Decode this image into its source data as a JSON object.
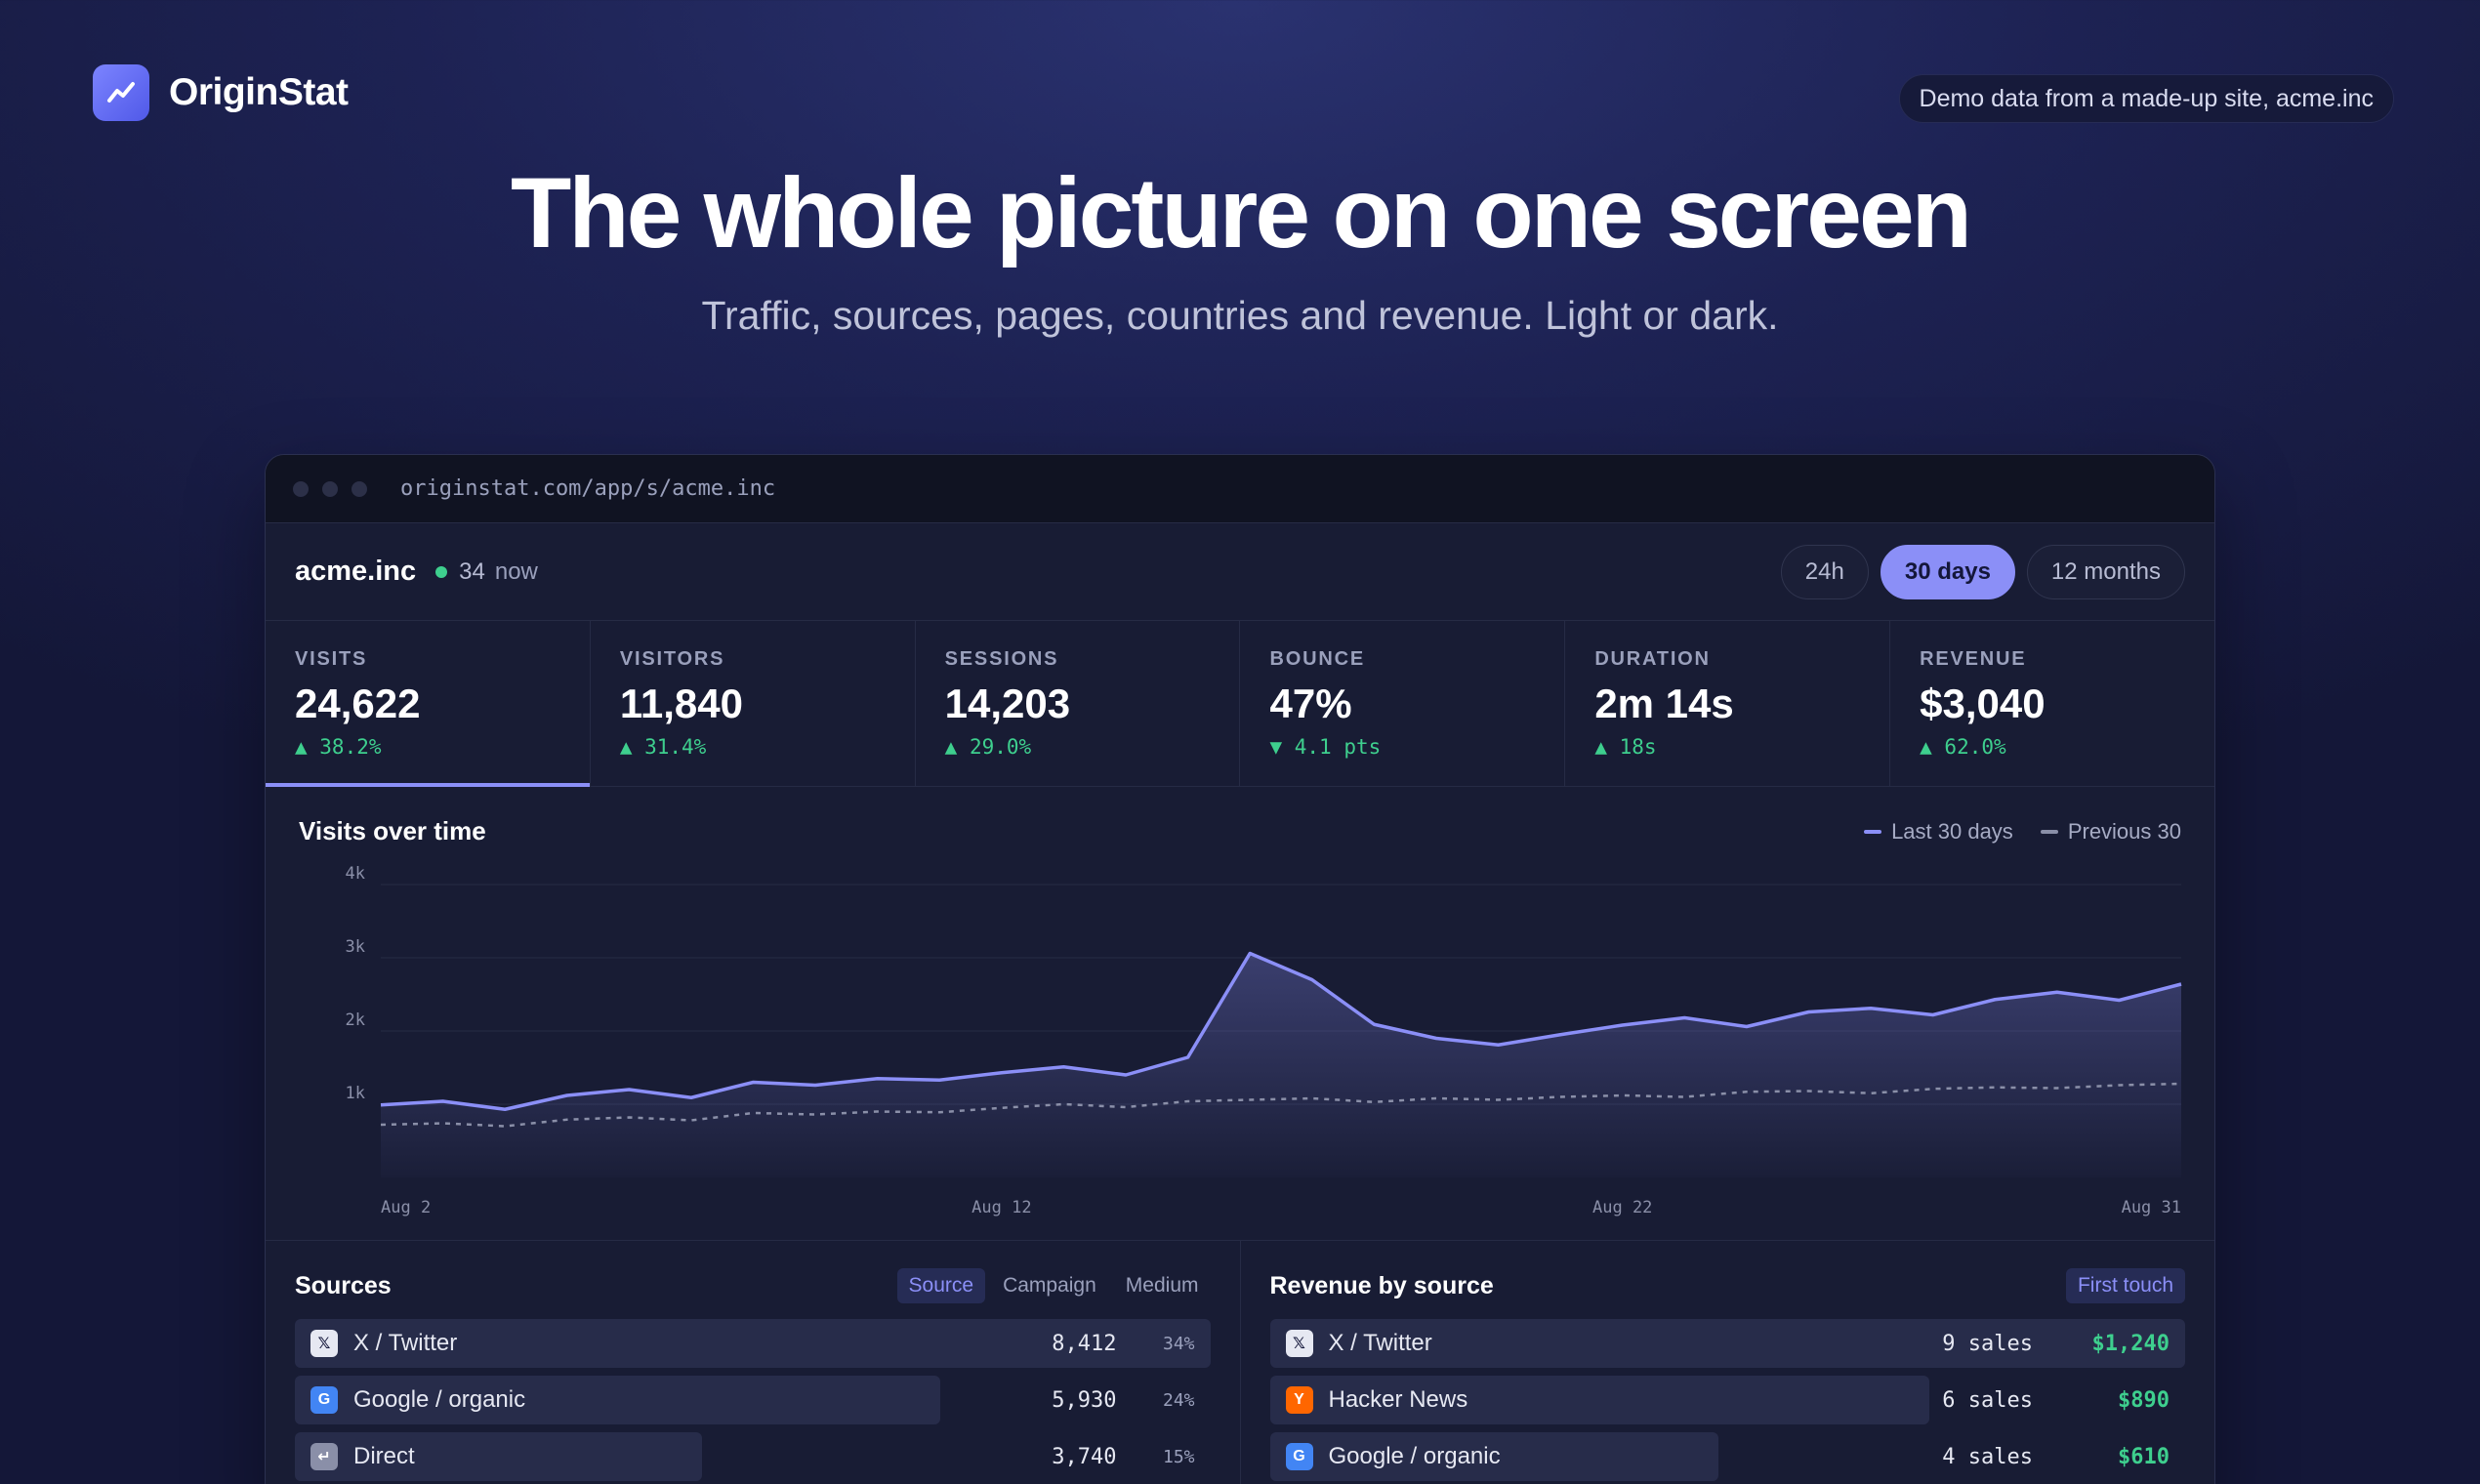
{
  "brand": {
    "name": "OriginStat",
    "logo_icon": "trend-up-icon"
  },
  "demo_note": "Demo data from a made-up site, acme.inc",
  "hero": {
    "title": "The whole picture on one screen",
    "subtitle": "Traffic, sources, pages, countries and revenue. Light or dark."
  },
  "window": {
    "url": "originstat.com/app/s/acme.inc"
  },
  "site": {
    "name": "acme.inc",
    "live_count": "34",
    "live_label": "now"
  },
  "ranges": [
    {
      "label": "24h",
      "active": false
    },
    {
      "label": "30 days",
      "active": true
    },
    {
      "label": "12 months",
      "active": false
    }
  ],
  "kpis": [
    {
      "label": "VISITS",
      "value": "24,622",
      "delta": "▲ 38.2%"
    },
    {
      "label": "VISITORS",
      "value": "11,840",
      "delta": "▲ 31.4%"
    },
    {
      "label": "SESSIONS",
      "value": "14,203",
      "delta": "▲ 29.0%"
    },
    {
      "label": "BOUNCE",
      "value": "47%",
      "delta": "▼ 4.1 pts"
    },
    {
      "label": "DURATION",
      "value": "2m 14s",
      "delta": "▲ 18s"
    },
    {
      "label": "REVENUE",
      "value": "$3,040",
      "delta": "▲ 62.0%"
    }
  ],
  "colors": {
    "accent": "#8b8ff7",
    "positive": "#3ecf8e",
    "previous": "#8a8fa8"
  },
  "chart_data": {
    "type": "area",
    "title": "Visits over time",
    "x": [
      "Aug 2",
      "Aug 3",
      "Aug 4",
      "Aug 5",
      "Aug 6",
      "Aug 7",
      "Aug 8",
      "Aug 9",
      "Aug 10",
      "Aug 11",
      "Aug 12",
      "Aug 13",
      "Aug 14",
      "Aug 15",
      "Aug 16",
      "Aug 17",
      "Aug 18",
      "Aug 19",
      "Aug 20",
      "Aug 21",
      "Aug 22",
      "Aug 23",
      "Aug 24",
      "Aug 25",
      "Aug 26",
      "Aug 27",
      "Aug 28",
      "Aug 29",
      "Aug 30",
      "Aug 31"
    ],
    "x_tick_labels": [
      "Aug 2",
      "Aug 12",
      "Aug 22",
      "Aug 31"
    ],
    "series": [
      {
        "name": "Last 30 days",
        "style": "solid",
        "values": [
          990,
          1040,
          930,
          1120,
          1200,
          1090,
          1300,
          1260,
          1350,
          1330,
          1430,
          1510,
          1400,
          1640,
          3060,
          2700,
          2090,
          1900,
          1810,
          1950,
          2080,
          2180,
          2060,
          2260,
          2310,
          2220,
          2430,
          2530,
          2420,
          2640
        ]
      },
      {
        "name": "Previous 30",
        "style": "dashed",
        "values": [
          720,
          740,
          700,
          790,
          820,
          780,
          880,
          860,
          900,
          890,
          950,
          1000,
          960,
          1040,
          1060,
          1080,
          1030,
          1080,
          1060,
          1100,
          1120,
          1100,
          1170,
          1180,
          1150,
          1210,
          1230,
          1220,
          1260,
          1280
        ]
      }
    ],
    "y_ticks": [
      1000,
      2000,
      3000,
      4000
    ],
    "y_tick_labels": [
      "1k",
      "2k",
      "3k",
      "4k"
    ],
    "ylim": [
      0,
      4000
    ],
    "grid": true,
    "legend": "top-right"
  },
  "sources": {
    "title": "Sources",
    "tabs": [
      {
        "label": "Source",
        "active": true
      },
      {
        "label": "Campaign",
        "active": false
      },
      {
        "label": "Medium",
        "active": false
      }
    ],
    "rows": [
      {
        "icon": "x-twitter-icon",
        "glyph": "𝕏",
        "color": "#e6e8f2",
        "label": "X / Twitter",
        "value": "8,412",
        "pct": "34%",
        "share": 1.0
      },
      {
        "icon": "google-icon",
        "glyph": "G",
        "color": "#4285f4",
        "label": "Google / organic",
        "value": "5,930",
        "pct": "24%",
        "share": 0.705
      },
      {
        "icon": "direct-icon",
        "glyph": "↵",
        "color": "#8a8fa8",
        "label": "Direct",
        "value": "3,740",
        "pct": "15%",
        "share": 0.445
      }
    ]
  },
  "revenue": {
    "title": "Revenue by source",
    "mode": "First touch",
    "rows": [
      {
        "icon": "x-twitter-icon",
        "glyph": "𝕏",
        "color": "#e6e8f2",
        "label": "X / Twitter",
        "sales": "9 sales",
        "amount": "$1,240",
        "share": 1.0
      },
      {
        "icon": "hacker-news-icon",
        "glyph": "Y",
        "color": "#ff6600",
        "label": "Hacker News",
        "sales": "6 sales",
        "amount": "$890",
        "share": 0.72
      },
      {
        "icon": "google-icon",
        "glyph": "G",
        "color": "#4285f4",
        "label": "Google / organic",
        "sales": "4 sales",
        "amount": "$610",
        "share": 0.49
      }
    ]
  }
}
